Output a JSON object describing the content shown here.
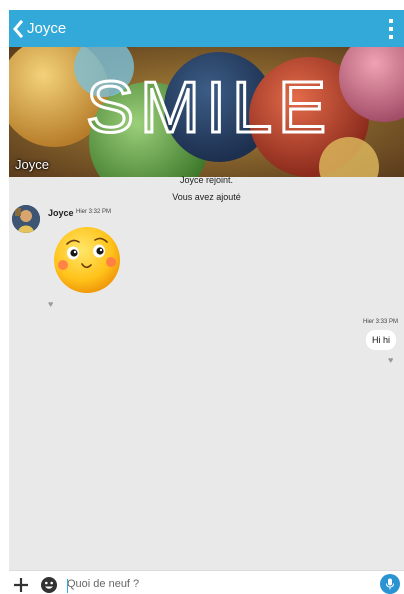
{
  "header": {
    "title": "Joyce",
    "back_icon": "chevron-left-icon",
    "menu_icon": "more-vert-icon",
    "color": "#33a9d9"
  },
  "cover": {
    "art_text": "SMILE",
    "name": "Joyce"
  },
  "system_messages": [
    "Joyce rejoint.",
    "Vous avez ajouté"
  ],
  "messages": [
    {
      "direction": "incoming",
      "sender": "Joyce",
      "time": "Hier 3:32 PM",
      "type": "sticker",
      "sticker": "smiling-face"
    },
    {
      "direction": "outgoing",
      "time": "Hier 3:33 PM",
      "type": "text",
      "text": "Hi hi"
    }
  ],
  "composer": {
    "placeholder": "Quoi de neuf ?",
    "value": "",
    "plus_icon": "plus-icon",
    "emoji_icon": "emoji-icon",
    "mic_icon": "mic-icon",
    "mic_color": "#2a93d2"
  }
}
